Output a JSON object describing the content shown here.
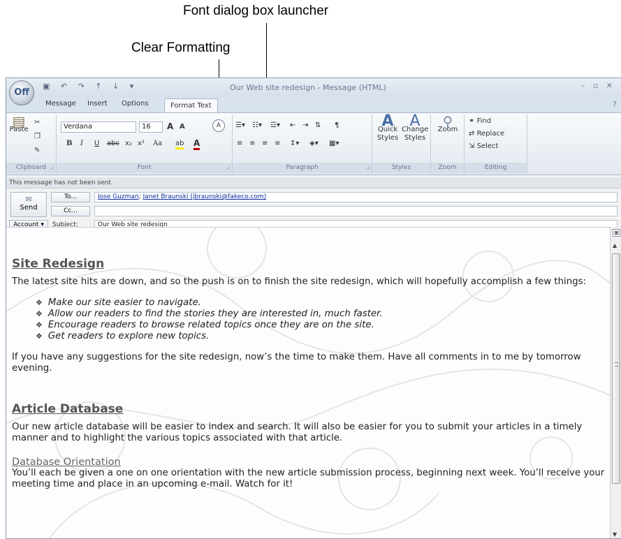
{
  "callouts": {
    "font_dialog_launcher": "Font dialog box launcher",
    "clear_formatting": "Clear Formatting"
  },
  "window": {
    "title": "Our Web site redesign - Message (HTML)",
    "office_button": "Off",
    "qat": "▣ ↶ ↷ ↑ ↓ ▾",
    "controls": "– ▫ ✕",
    "help": "?"
  },
  "tabs": [
    "Message",
    "Insert",
    "Options",
    "Format Text"
  ],
  "ribbon": {
    "clipboard": {
      "label": "Clipboard",
      "paste": "Paste"
    },
    "font": {
      "label": "Font",
      "name": "Verdana",
      "size": "16",
      "grow": "A",
      "shrink": "A",
      "clear": "A",
      "bold": "B",
      "italic": "I",
      "underline": "U",
      "strike": "abc",
      "subscript": "x₂",
      "superscript": "x²",
      "case": "Aa",
      "highlight": "ab",
      "color": "A"
    },
    "paragraph": {
      "label": "Paragraph"
    },
    "styles": {
      "label": "Styles",
      "quick": "Quick Styles",
      "change": "Change Styles"
    },
    "zoom": {
      "label": "Zoom",
      "button": "Zoom"
    },
    "editing": {
      "label": "Editing",
      "find": "Find",
      "replace": "Replace",
      "select": "Select"
    },
    "launcher": "⌟"
  },
  "infobar": "This message has not been sent.",
  "header": {
    "send": "Send",
    "to_button": "To...",
    "cc_button": "Cc...",
    "account": "Account",
    "subject_label": "Subject:",
    "to_value_1": "Jose Guzman",
    "to_sep": ";",
    "to_value_2": "Janet Braunski (jbraunski@fakeco.com)",
    "cc_value": "",
    "subject_value": "Our Web site redesign"
  },
  "message": {
    "h1": "Site Redesign",
    "p1": "The latest site hits are down, and so the push is on to finish the site redesign, which will hopefully accomplish a few things:",
    "bullets": [
      "Make our site easier to navigate.",
      "Allow our readers to find the stories they are interested in, much faster.",
      "Encourage readers to browse related topics once they are on the site.",
      "Get readers to explore new topics."
    ],
    "p2": "If you have any suggestions for the site redesign, now’s the time to make them. Have all comments in to me by tomorrow evening.",
    "h2": "Article Database",
    "p3": "Our new article database will be easier to index and search. It will also be easier for you to submit your articles in a timely manner and to highlight the various topics associated with that article.",
    "h3": "Database Orientation",
    "p4": "You’ll each be given a one on one orientation with the new article submission process, beginning next week. You’ll receive your meeting time and place in an upcoming e-mail. Watch for it!"
  }
}
